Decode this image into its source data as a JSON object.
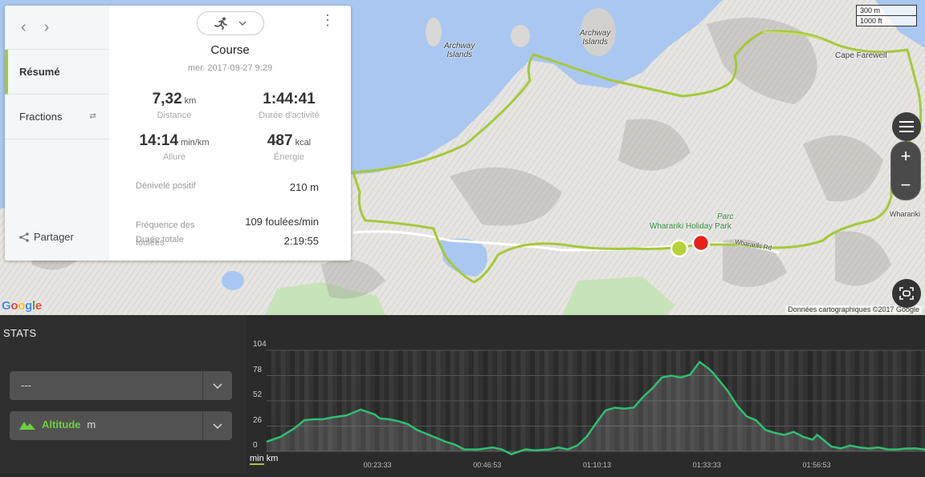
{
  "map": {
    "labels": [
      {
        "text": "Archway\nIslands",
        "id": "archway-islands-1"
      },
      {
        "text": "Archway\nIslands",
        "id": "archway-islands-2"
      },
      {
        "text": "Cape Farewell",
        "id": "cape-farewell"
      },
      {
        "text": "Wharariki",
        "id": "wharariki"
      }
    ],
    "park_label": "Parc",
    "holiday_park_label": "Wharariki Holiday Park",
    "road_label": "Wharariki Rd",
    "scale": {
      "metric": "300 m",
      "imperial": "1000 ft"
    },
    "credit": "Données cartographiques ©2017 Google",
    "google_logo": "Google",
    "controls": {
      "zoom_in": "+",
      "zoom_out": "−"
    },
    "colors": {
      "water": "#a9c7f0",
      "land": "#e9e8e4",
      "route": "#a6c83a",
      "start": "#b5d334",
      "end": "#e8201a",
      "park": "#c7e3b9"
    }
  },
  "card": {
    "sidebar": {
      "items": [
        {
          "label": "Résumé",
          "active": true
        },
        {
          "label": "Fractions",
          "active": false
        }
      ],
      "share_label": "Partager"
    },
    "activity": {
      "title": "Course",
      "date": "mer. 2017-09-27 9:29",
      "sport_icon": "running-icon"
    },
    "stats": {
      "distance": {
        "value": "7,32",
        "unit": "km",
        "label": "Distance"
      },
      "duration": {
        "value": "1:44:41",
        "unit": "",
        "label": "Durée d'activité"
      },
      "pace": {
        "value": "14:14",
        "unit": "min/km",
        "label": "Allure"
      },
      "energy": {
        "value": "487",
        "unit": "kcal",
        "label": "Énergie"
      }
    },
    "details": [
      {
        "label": "Dénivelé positif",
        "value": "210 m"
      },
      {
        "label": "Fréquence des\nfoulées",
        "value": "109 foulées/min"
      },
      {
        "label": "Durée totale",
        "value": "2:19:55"
      }
    ]
  },
  "stats_panel": {
    "title": "STATS",
    "dropdown1": "---",
    "dropdown2": {
      "label": "Altitude",
      "unit": "m"
    }
  },
  "chart_data": {
    "type": "area",
    "title": "",
    "xlabel": "min",
    "xlabel_alt": "km",
    "ylabel": "",
    "ylim": [
      0,
      104
    ],
    "yticks": [
      "104",
      "78",
      "52",
      "26",
      "0"
    ],
    "xticks": [
      "00:23:33",
      "00:46:53",
      "01:10:13",
      "01:33:33",
      "01:56:53"
    ],
    "xlim_minutes": [
      0,
      139.9
    ],
    "series": [
      {
        "color": "#2fbf71",
        "x": [
          0,
          3,
          6,
          8,
          10,
          12,
          14,
          17,
          20,
          23,
          24,
          26,
          28,
          30,
          32,
          35,
          38,
          40,
          42,
          45,
          48,
          50,
          52,
          55,
          57,
          60,
          62,
          64,
          66,
          68,
          70,
          72,
          74,
          76,
          78,
          80,
          82,
          84,
          86,
          88,
          90,
          92,
          94,
          95,
          96,
          98,
          100,
          102,
          104,
          106,
          108,
          110,
          112,
          114,
          116,
          117,
          118,
          120,
          122,
          124,
          126,
          128,
          130,
          132,
          134,
          136,
          138,
          139.9
        ],
        "values": [
          10,
          15,
          24,
          32,
          33,
          33,
          35,
          37,
          43,
          38,
          34,
          33,
          31,
          28,
          22,
          16,
          10,
          7,
          2,
          2,
          4,
          2,
          -3,
          2,
          1,
          2,
          4,
          2,
          6,
          15,
          29,
          42,
          45,
          44,
          45,
          56,
          65,
          76,
          78,
          76,
          79,
          92,
          85,
          80,
          74,
          62,
          47,
          36,
          32,
          22,
          19,
          17,
          20,
          15,
          12,
          17,
          13,
          5,
          3,
          6,
          4,
          3,
          4,
          2,
          2,
          3,
          3,
          2
        ]
      }
    ]
  }
}
